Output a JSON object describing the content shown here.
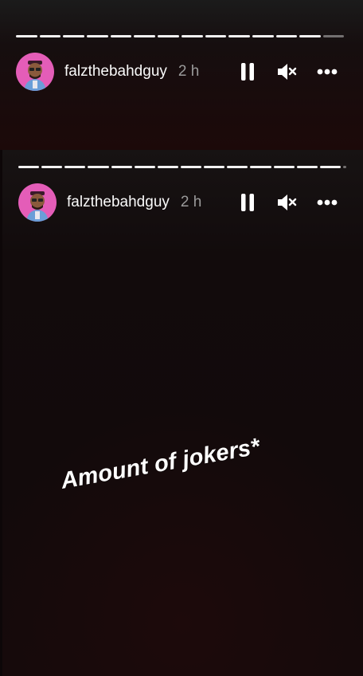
{
  "back_story": {
    "username": "falzthebahdguy",
    "time": "2 h",
    "progress_completed_fraction": 0.93
  },
  "front_story": {
    "username": "falzthebahdguy",
    "time": "2 h",
    "progress_completed_fraction": 0.99,
    "caption": "Amount of jokers*"
  },
  "icons": {
    "pause": "pause-icon",
    "mute": "volume-muted-icon",
    "more": "more-options-icon"
  },
  "colors": {
    "avatar_bg": "#e45db8",
    "time_text": "#9a9a9a"
  }
}
